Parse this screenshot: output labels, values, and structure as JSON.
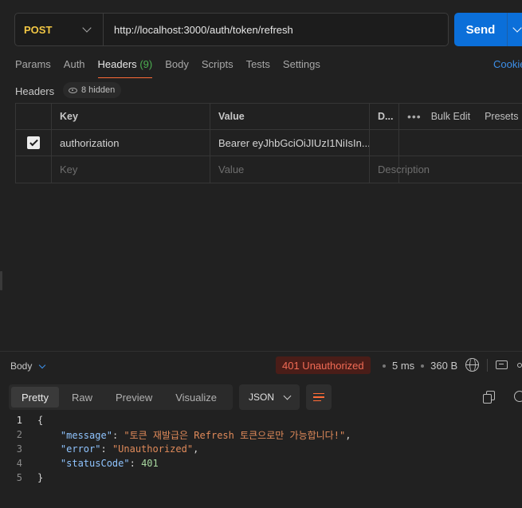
{
  "request": {
    "method": "POST",
    "url": "http://localhost:3000/auth/token/refresh",
    "send_label": "Send"
  },
  "tabs": [
    {
      "label": "Params"
    },
    {
      "label": "Auth"
    },
    {
      "label": "Headers",
      "count": "(9)"
    },
    {
      "label": "Body"
    },
    {
      "label": "Scripts"
    },
    {
      "label": "Tests"
    },
    {
      "label": "Settings"
    }
  ],
  "cookies_label": "Cookies",
  "headers_section": {
    "title": "Headers",
    "hidden_label": "8 hidden",
    "columns": {
      "key": "Key",
      "value": "Value",
      "description": "D..."
    },
    "bulk_edit": "Bulk Edit",
    "presets": "Presets",
    "rows": [
      {
        "key": "authorization",
        "value": "Bearer eyJhbGciOiJIUzI1NiIsIn...",
        "checked": true
      }
    ],
    "placeholders": {
      "key": "Key",
      "value": "Value",
      "description": "Description"
    }
  },
  "response": {
    "body_label": "Body",
    "status": "401 Unauthorized",
    "time": "5 ms",
    "size": "360 B",
    "view_tabs": [
      "Pretty",
      "Raw",
      "Preview",
      "Visualize"
    ],
    "format": "JSON",
    "lines": [
      {
        "n": "1"
      },
      {
        "n": "2",
        "key": "\"message\"",
        "value": "\"토큰 재발급은 Refresh 토큰으로만 가능합니다!\""
      },
      {
        "n": "3",
        "key": "\"error\"",
        "value": "\"Unauthorized\""
      },
      {
        "n": "4",
        "key": "\"statusCode\"",
        "value": "401"
      },
      {
        "n": "5"
      }
    ]
  },
  "colors": {
    "accent": "#ff6c37",
    "send": "#0b6fd9",
    "method": "#f2c744",
    "error": "#f26b55"
  }
}
